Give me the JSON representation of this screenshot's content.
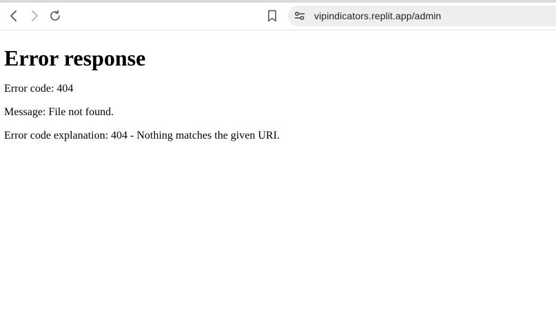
{
  "browser": {
    "url": "vipindicators.replit.app/admin",
    "icons": {
      "back": "chevron-left-icon",
      "forward": "chevron-right-icon",
      "reload": "reload-icon",
      "bookmark": "bookmark-icon",
      "site_settings": "tune-icon"
    }
  },
  "page": {
    "heading": "Error response",
    "error_code": "Error code: 404",
    "message": "Message: File not found.",
    "explanation": "Error code explanation: 404 - Nothing matches the given URI."
  }
}
